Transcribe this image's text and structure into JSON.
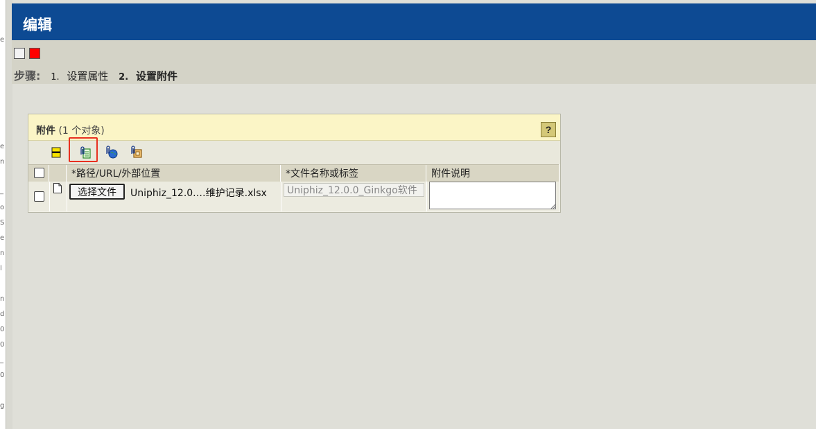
{
  "window": {
    "title": "编辑"
  },
  "steps": {
    "label": "步骤:",
    "items": [
      {
        "num": "1.",
        "label": "设置属性",
        "active": false
      },
      {
        "num": "2.",
        "label": "设置附件",
        "active": true
      }
    ]
  },
  "panel": {
    "title": "附件",
    "count": "(1 个对象)",
    "help_label": "?",
    "toolbar": [
      {
        "icon": "select-all-icon"
      },
      {
        "icon": "attach-local-file-icon",
        "highlighted": true
      },
      {
        "icon": "attach-url-icon"
      },
      {
        "icon": "attach-external-icon"
      }
    ],
    "columns": [
      "*路径/URL/外部位置",
      "*文件名称或标签",
      "附件说明"
    ],
    "rows": [
      {
        "choose_button": "选择文件",
        "file_path": "Uniphiz_12.0.…维护记录.xlsx",
        "label_value": "Uniphiz_12.0.0_Ginkgo软件",
        "description": ""
      }
    ]
  },
  "colors": {
    "title_bar": "#0d4a93",
    "panel_header": "#fbf5c6",
    "highlight": "#e83020"
  }
}
